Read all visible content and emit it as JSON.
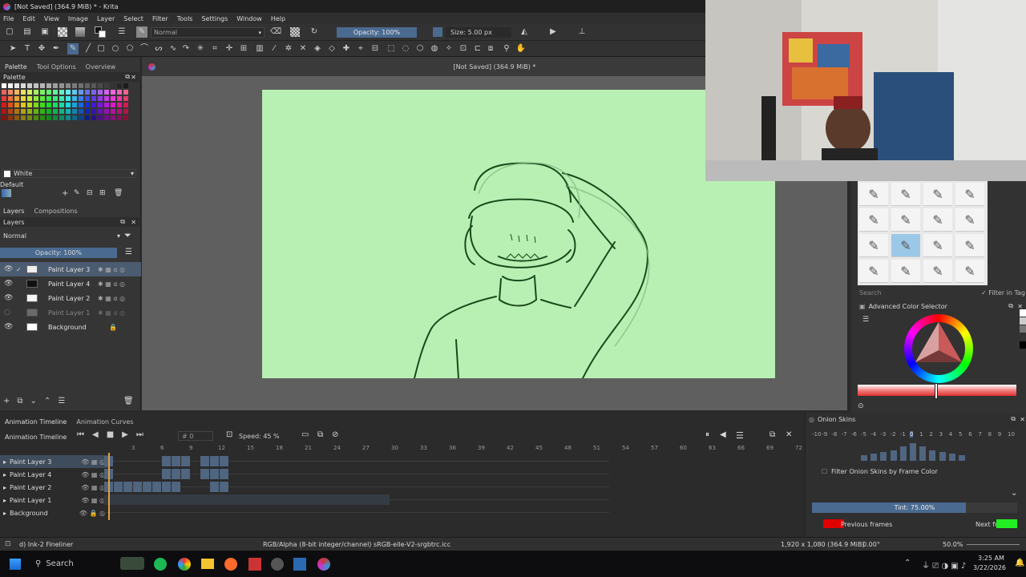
{
  "window": {
    "title": "[Not Saved]  (364.9 MiB) * - Krita"
  },
  "menu": [
    "File",
    "Edit",
    "View",
    "Image",
    "Layer",
    "Select",
    "Filter",
    "Tools",
    "Settings",
    "Window",
    "Help"
  ],
  "toolbar": {
    "blend_mode": "Normal",
    "opacity": "Opacity: 100%",
    "size": "Size: 5.00 px"
  },
  "canvas_tab": {
    "title": "[Not Saved]  (364.9 MiB) *"
  },
  "left_tabs": [
    "Palette",
    "Tool Options",
    "Overview"
  ],
  "palette": {
    "title": "Palette",
    "color_name": "White",
    "palette_name": "Default"
  },
  "layers_panel": {
    "tabs": [
      "Layers",
      "Compositions"
    ],
    "blend_mode": "Normal",
    "opacity": "Opacity: 100%",
    "layers": [
      {
        "name": "Paint Layer 3",
        "selected": true
      },
      {
        "name": "Paint Layer 4",
        "selected": false
      },
      {
        "name": "Paint Layer 2",
        "selected": false
      },
      {
        "name": "Paint Layer 1",
        "selected": false
      },
      {
        "name": "Background",
        "selected": false
      }
    ]
  },
  "timeline": {
    "tabs": [
      "Animation Timeline",
      "Animation Curves"
    ],
    "title": "Animation Timeline",
    "frame": "0",
    "speed": "Speed: 45 %",
    "ruler": [
      "3",
      "6",
      "9",
      "12",
      "15",
      "18",
      "21",
      "24",
      "27",
      "30",
      "33",
      "36",
      "39",
      "42",
      "45",
      "48",
      "51",
      "54",
      "57",
      "60",
      "63",
      "66",
      "69",
      "72"
    ],
    "layers": [
      "Paint Layer 3",
      "Paint Layer 4",
      "Paint Layer 2",
      "Paint Layer 1",
      "Background"
    ]
  },
  "onion": {
    "title": "Onion Skins",
    "numbers": [
      "-10",
      "-9",
      "-8",
      "-7",
      "-6",
      "-5",
      "-4",
      "-3",
      "-2",
      "-1",
      "0",
      "1",
      "2",
      "3",
      "4",
      "5",
      "6",
      "7",
      "8",
      "9",
      "10"
    ],
    "filter_label": "Filter Onion Skins by Frame Color",
    "tint": "Tint: 75.00%",
    "tint_fraction": 0.75,
    "previous": "Previous frames",
    "next": "Next frames",
    "previous_color": "#e00000",
    "next_color": "#22ee22"
  },
  "brush_presets": {
    "search_placeholder": "Search",
    "filter_in_tag": "Filter in Tag"
  },
  "color_selector": {
    "title": "Advanced Color Selector"
  },
  "status": {
    "brush": "d) Ink-2 Fineliner",
    "colorspace": "RGB/Alpha (8-bit integer/channel)  sRGB-elle-V2-srgbtrc.icc",
    "dimensions": "1,920 x 1,080 (364.9 MiB)",
    "rotation": "0.00°",
    "zoom": "50.0%"
  },
  "taskbar": {
    "search": "Search",
    "time": "3:25 AM",
    "date": "3/22/2026"
  },
  "colors": {
    "canvas_bg": "#b8f0b4",
    "stroke": "#1a4a1a",
    "selection": "#4b5b70",
    "accent": "#4a6a90"
  }
}
